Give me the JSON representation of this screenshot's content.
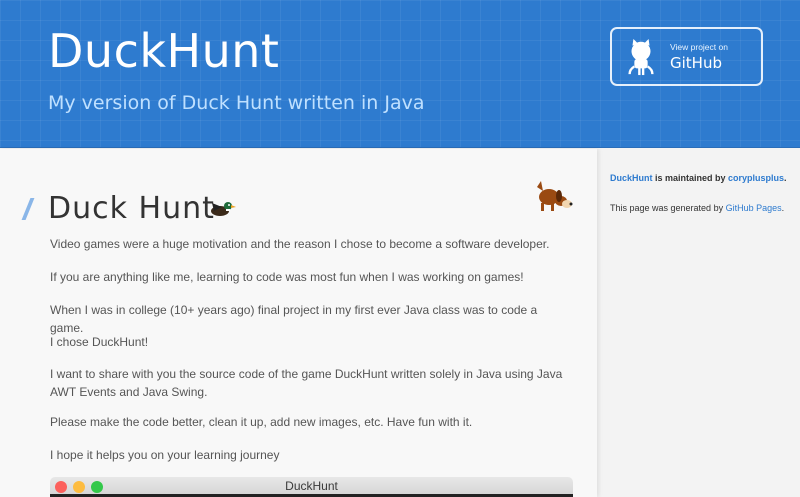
{
  "header": {
    "title": "DuckHunt",
    "tagline": "My version of Duck Hunt written in Java",
    "github_button": {
      "small_label": "View project on",
      "big_label": "GitHub"
    }
  },
  "main": {
    "heading": "Duck Hunt",
    "paragraphs": [
      "Video games were a huge motivation and the reason I chose to become a software developer.",
      "If you are anything like me, learning to code was most fun when I was working on games!",
      "When I was in college (10+ years ago) final project in my first ever Java class was to code a game.",
      "I chose DuckHunt!",
      "I want to share with you the source code of the game DuckHunt written solely in Java using Java AWT Events and Java Swing.",
      "Please make the code better, clean it up, add new images, etc. Have fun with it.",
      "I hope it helps you on your learning journey"
    ],
    "window_title": "DuckHunt"
  },
  "sidebar": {
    "project_link": "DuckHunt",
    "maintained_text": " is maintained by ",
    "maintainer_link": "coryplusplus",
    "maintainer_suffix": ".",
    "generated_text": "This page was generated by ",
    "generated_link": "GitHub Pages",
    "generated_suffix": "."
  },
  "colors": {
    "header_bg": "#2e7bcf",
    "tagline": "#bfe0ff",
    "link": "#2e7bcf"
  },
  "icons": [
    "github-octocat-icon",
    "duck-icon",
    "dog-icon",
    "close-dot-icon",
    "minimize-dot-icon",
    "zoom-dot-icon"
  ]
}
